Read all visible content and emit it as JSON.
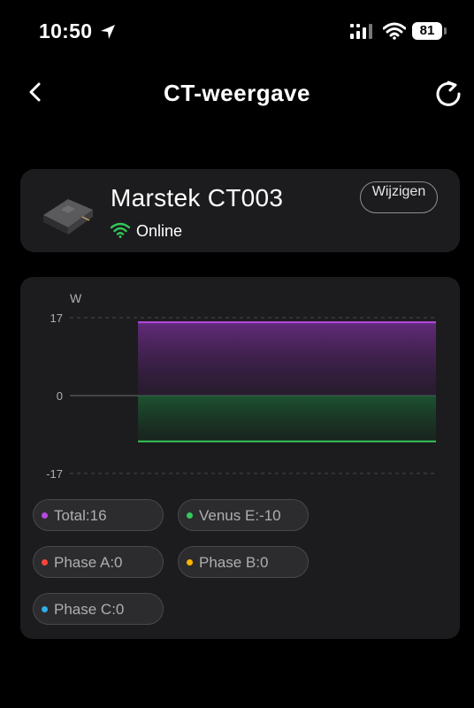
{
  "status_bar": {
    "time": "10:50",
    "battery": "81"
  },
  "nav": {
    "title": "CT-weergave",
    "back_icon": "chevron-left-icon",
    "refresh_icon": "refresh-icon"
  },
  "device": {
    "name": "Marstek CT003",
    "status": "Online",
    "edit_label": "Wijzigen",
    "status_color": "#34c759"
  },
  "chart_data": {
    "type": "area",
    "ylabel": "W",
    "yticks": [
      "17",
      "0",
      "-17"
    ],
    "ylim": [
      -17,
      17
    ],
    "series": [
      {
        "name": "Total",
        "value": 16,
        "color": "#b44ae0"
      },
      {
        "name": "Venus E",
        "value": -10,
        "color": "#34c759"
      }
    ],
    "grid": true
  },
  "legend": [
    {
      "label": "Total:16",
      "color": "#b44ae0"
    },
    {
      "label": "Venus E:-10",
      "color": "#34c759"
    },
    {
      "label": "Phase A:0",
      "color": "#ff453a"
    },
    {
      "label": "Phase B:0",
      "color": "#ffb300"
    },
    {
      "label": "Phase C:0",
      "color": "#32ade6"
    }
  ]
}
